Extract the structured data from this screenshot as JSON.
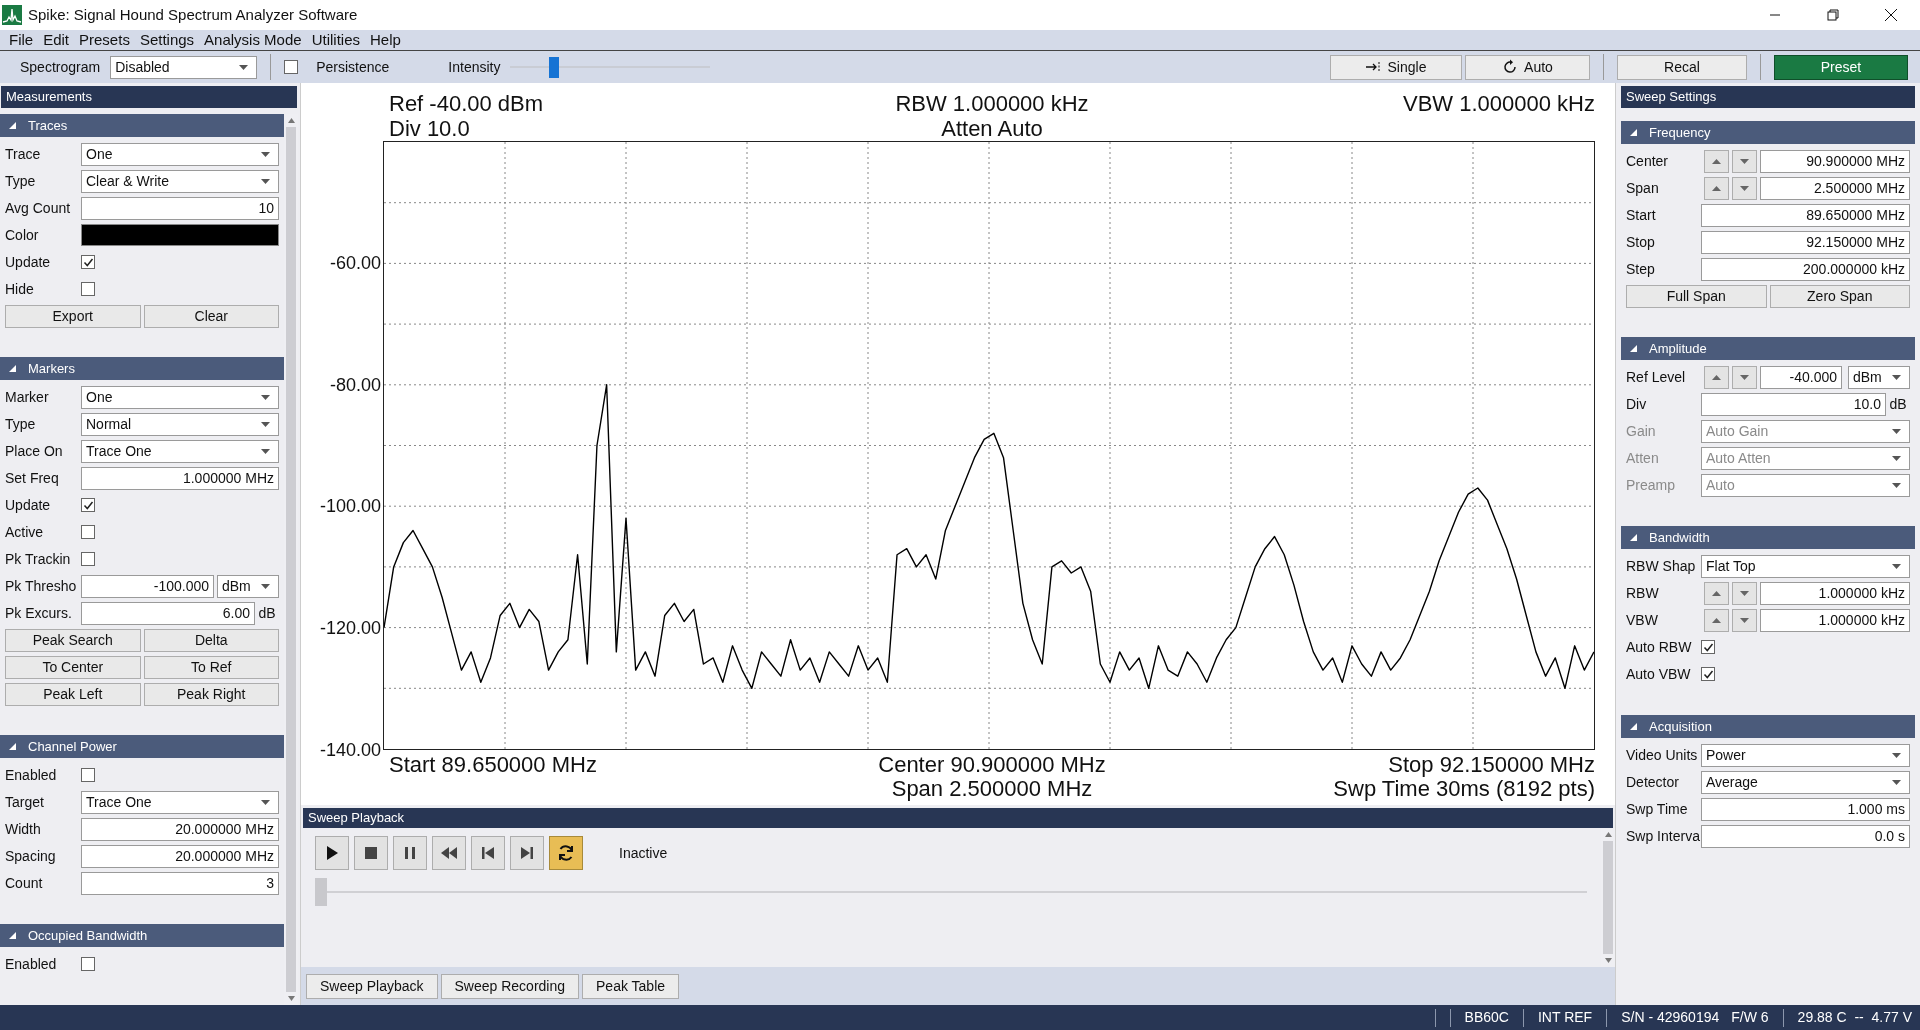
{
  "window": {
    "title": "Spike: Signal Hound Spectrum Analyzer Software"
  },
  "menu": [
    "File",
    "Edit",
    "Presets",
    "Settings",
    "Analysis Mode",
    "Utilities",
    "Help"
  ],
  "toolbar": {
    "spectrogram": {
      "label": "Spectrogram",
      "value": "Disabled"
    },
    "persistence": {
      "label": "Persistence",
      "checked": false
    },
    "intensity": {
      "label": "Intensity",
      "level": 0.22
    },
    "buttons": [
      {
        "label": "Single",
        "kind": "single"
      },
      {
        "label": "Auto",
        "kind": "auto"
      },
      {
        "label": "Recal",
        "kind": "plain"
      },
      {
        "label": "Preset",
        "kind": "primary"
      }
    ]
  },
  "measurements": {
    "title": "Measurements",
    "sections": [
      {
        "title": "Traces",
        "rows": [
          {
            "kind": "dropdown",
            "label": "Trace",
            "value": "One",
            "disabled": false
          },
          {
            "kind": "dropdown",
            "label": "Type",
            "value": "Clear & Write",
            "disabled": false
          },
          {
            "kind": "field",
            "label": "Avg Count",
            "value": "10"
          },
          {
            "kind": "color",
            "label": "Color",
            "color": "#000000"
          },
          {
            "kind": "check",
            "label": "Update",
            "checked": true
          },
          {
            "kind": "check",
            "label": "Hide",
            "checked": false
          },
          {
            "kind": "buttons",
            "labels": [
              "Export",
              "Clear"
            ]
          }
        ]
      },
      {
        "title": "Markers",
        "rows": [
          {
            "kind": "dropdown",
            "label": "Marker",
            "value": "One",
            "disabled": false
          },
          {
            "kind": "dropdown",
            "label": "Type",
            "value": "Normal",
            "disabled": false
          },
          {
            "kind": "dropdown",
            "label": "Place On",
            "value": "Trace One",
            "disabled": false
          },
          {
            "kind": "field",
            "label": "Set Freq",
            "value": "1.000000 MHz"
          },
          {
            "kind": "check",
            "label": "Update",
            "checked": true
          },
          {
            "kind": "check",
            "label": "Active",
            "checked": false
          },
          {
            "kind": "check",
            "label": "Pk Trackin",
            "checked": false
          },
          {
            "kind": "field",
            "label": "Pk Thresho",
            "value": "-100.000",
            "unit_menu": "dBm"
          },
          {
            "kind": "field",
            "label": "Pk Excurs.",
            "value": "6.00",
            "unit": "dB"
          },
          {
            "kind": "buttons",
            "labels": [
              "Peak Search",
              "Delta"
            ]
          },
          {
            "kind": "buttons",
            "labels": [
              "To Center",
              "To Ref"
            ]
          },
          {
            "kind": "buttons",
            "labels": [
              "Peak Left",
              "Peak Right"
            ]
          }
        ]
      },
      {
        "title": "Channel Power",
        "rows": [
          {
            "kind": "check",
            "label": "Enabled",
            "checked": false
          },
          {
            "kind": "dropdown",
            "label": "Target",
            "value": "Trace One",
            "disabled": false
          },
          {
            "kind": "field",
            "label": "Width",
            "value": "20.000000 MHz"
          },
          {
            "kind": "field",
            "label": "Spacing",
            "value": "20.000000 MHz"
          },
          {
            "kind": "field",
            "label": "Count",
            "value": "3"
          }
        ]
      },
      {
        "title": "Occupied Bandwidth",
        "rows": [
          {
            "kind": "check",
            "label": "Enabled",
            "checked": false
          }
        ]
      }
    ]
  },
  "plot": {
    "ref": "Ref -40.00 dBm",
    "div": "Div 10.0",
    "rbw": "RBW 1.000000 kHz",
    "atten": "Atten Auto",
    "vbw": "VBW 1.000000 kHz",
    "chart_data": {
      "type": "line",
      "grid": true,
      "ylim": [
        -140,
        -40
      ],
      "yticks": [
        {
          "value": -60,
          "label": "-60.00"
        },
        {
          "value": -80,
          "label": "-80.00"
        },
        {
          "value": -100,
          "label": "-100.00"
        },
        {
          "value": -120,
          "label": "-120.00"
        },
        {
          "value": -140,
          "label": "-140.00"
        }
      ],
      "series": [
        {
          "color": "#000000",
          "values": [
            -120,
            -110,
            -106,
            -104,
            -107,
            -110,
            -115,
            -121,
            -127,
            -124,
            -129,
            -125,
            -118,
            -116,
            -120,
            -117,
            -119,
            -127,
            -124,
            -122,
            -108,
            -126,
            -90,
            -80,
            -124,
            -102,
            -127,
            -124,
            -128,
            -118,
            -116,
            -119,
            -117,
            -126,
            -125,
            -129,
            -123,
            -127,
            -130,
            -124,
            -126,
            -128,
            -122,
            -127,
            -125,
            -129,
            -124,
            -126,
            -128,
            -123,
            -127,
            -125,
            -129,
            -108,
            -107,
            -110,
            -108,
            -112,
            -104,
            -100,
            -96,
            -92,
            -89,
            -88,
            -92,
            -104,
            -116,
            -122,
            -126,
            -110,
            -109,
            -111,
            -110,
            -114,
            -126,
            -129,
            -124,
            -127,
            -125,
            -130,
            -123,
            -127,
            -128,
            -124,
            -126,
            -129,
            -125,
            -122,
            -120,
            -115,
            -110,
            -107,
            -105,
            -108,
            -113,
            -119,
            -124,
            -127,
            -125,
            -129,
            -123,
            -126,
            -128,
            -124,
            -127,
            -125,
            -122,
            -118,
            -114,
            -109,
            -105,
            -101,
            -98,
            -97,
            -99,
            -103,
            -107,
            -112,
            -118,
            -124,
            -128,
            -125,
            -130,
            -123,
            -127,
            -124
          ]
        }
      ]
    },
    "start": "Start 89.650000 MHz",
    "center": "Center 90.900000 MHz",
    "span": "Span 2.500000 MHz",
    "stop": "Stop 92.150000 MHz",
    "sweep_time": "Swp Time 30ms (8192 pts)"
  },
  "playback": {
    "title": "Sweep Playback",
    "controls": [
      {
        "kind": "play",
        "on": false
      },
      {
        "kind": "stop",
        "on": false
      },
      {
        "kind": "pause",
        "on": false
      },
      {
        "kind": "rewind",
        "on": false
      },
      {
        "kind": "skip_back",
        "on": false
      },
      {
        "kind": "skip_forward",
        "on": false
      },
      {
        "kind": "loop",
        "on": true
      }
    ],
    "status": "Inactive",
    "position": {
      "level": 0
    }
  },
  "bottom_tabs": [
    "Sweep Playback",
    "Sweep Recording",
    "Peak Table"
  ],
  "sweep_settings": {
    "title": "Sweep Settings",
    "sections": [
      {
        "title": "Frequency",
        "rows": [
          {
            "kind": "spin",
            "label": "Center",
            "value": "90.900000 MHz"
          },
          {
            "kind": "spin",
            "label": "Span",
            "value": "2.500000 MHz"
          },
          {
            "kind": "field",
            "label": "Start",
            "value": "89.650000 MHz"
          },
          {
            "kind": "field",
            "label": "Stop",
            "value": "92.150000 MHz"
          },
          {
            "kind": "field",
            "label": "Step",
            "value": "200.000000 kHz"
          },
          {
            "kind": "buttons",
            "labels": [
              "Full Span",
              "Zero Span"
            ]
          }
        ]
      },
      {
        "title": "Amplitude",
        "rows": [
          {
            "kind": "spin",
            "label": "Ref Level",
            "value": "-40.000",
            "unit_menu": "dBm"
          },
          {
            "kind": "field",
            "label": "Div",
            "value": "10.0",
            "unit": "dB"
          },
          {
            "kind": "dropdown",
            "label": "Gain",
            "value": "Auto Gain",
            "disabled": true
          },
          {
            "kind": "dropdown",
            "label": "Atten",
            "value": "Auto Atten",
            "disabled": true
          },
          {
            "kind": "dropdown",
            "label": "Preamp",
            "value": "Auto",
            "disabled": true
          }
        ]
      },
      {
        "title": "Bandwidth",
        "rows": [
          {
            "kind": "dropdown",
            "label": "RBW Shap",
            "value": "Flat Top",
            "disabled": false
          },
          {
            "kind": "spin",
            "label": "RBW",
            "value": "1.000000 kHz"
          },
          {
            "kind": "spin",
            "label": "VBW",
            "value": "1.000000 kHz"
          },
          {
            "kind": "check",
            "label": "Auto RBW",
            "checked": true
          },
          {
            "kind": "check",
            "label": "Auto VBW",
            "checked": true
          }
        ]
      },
      {
        "title": "Acquisition",
        "rows": [
          {
            "kind": "dropdown",
            "label": "Video Units",
            "value": "Power",
            "disabled": false
          },
          {
            "kind": "dropdown",
            "label": "Detector",
            "value": "Average",
            "disabled": false
          },
          {
            "kind": "field",
            "label": "Swp Time",
            "value": "1.000 ms"
          },
          {
            "kind": "field",
            "label": "Swp Interva",
            "value": "0.0 s"
          }
        ]
      }
    ]
  },
  "status_bar": [
    [
      "BB60C"
    ],
    [
      "INT REF"
    ],
    [
      "S/N - 42960194",
      "F/W 6"
    ],
    [
      "29.88 C  --  4.77 V"
    ]
  ]
}
